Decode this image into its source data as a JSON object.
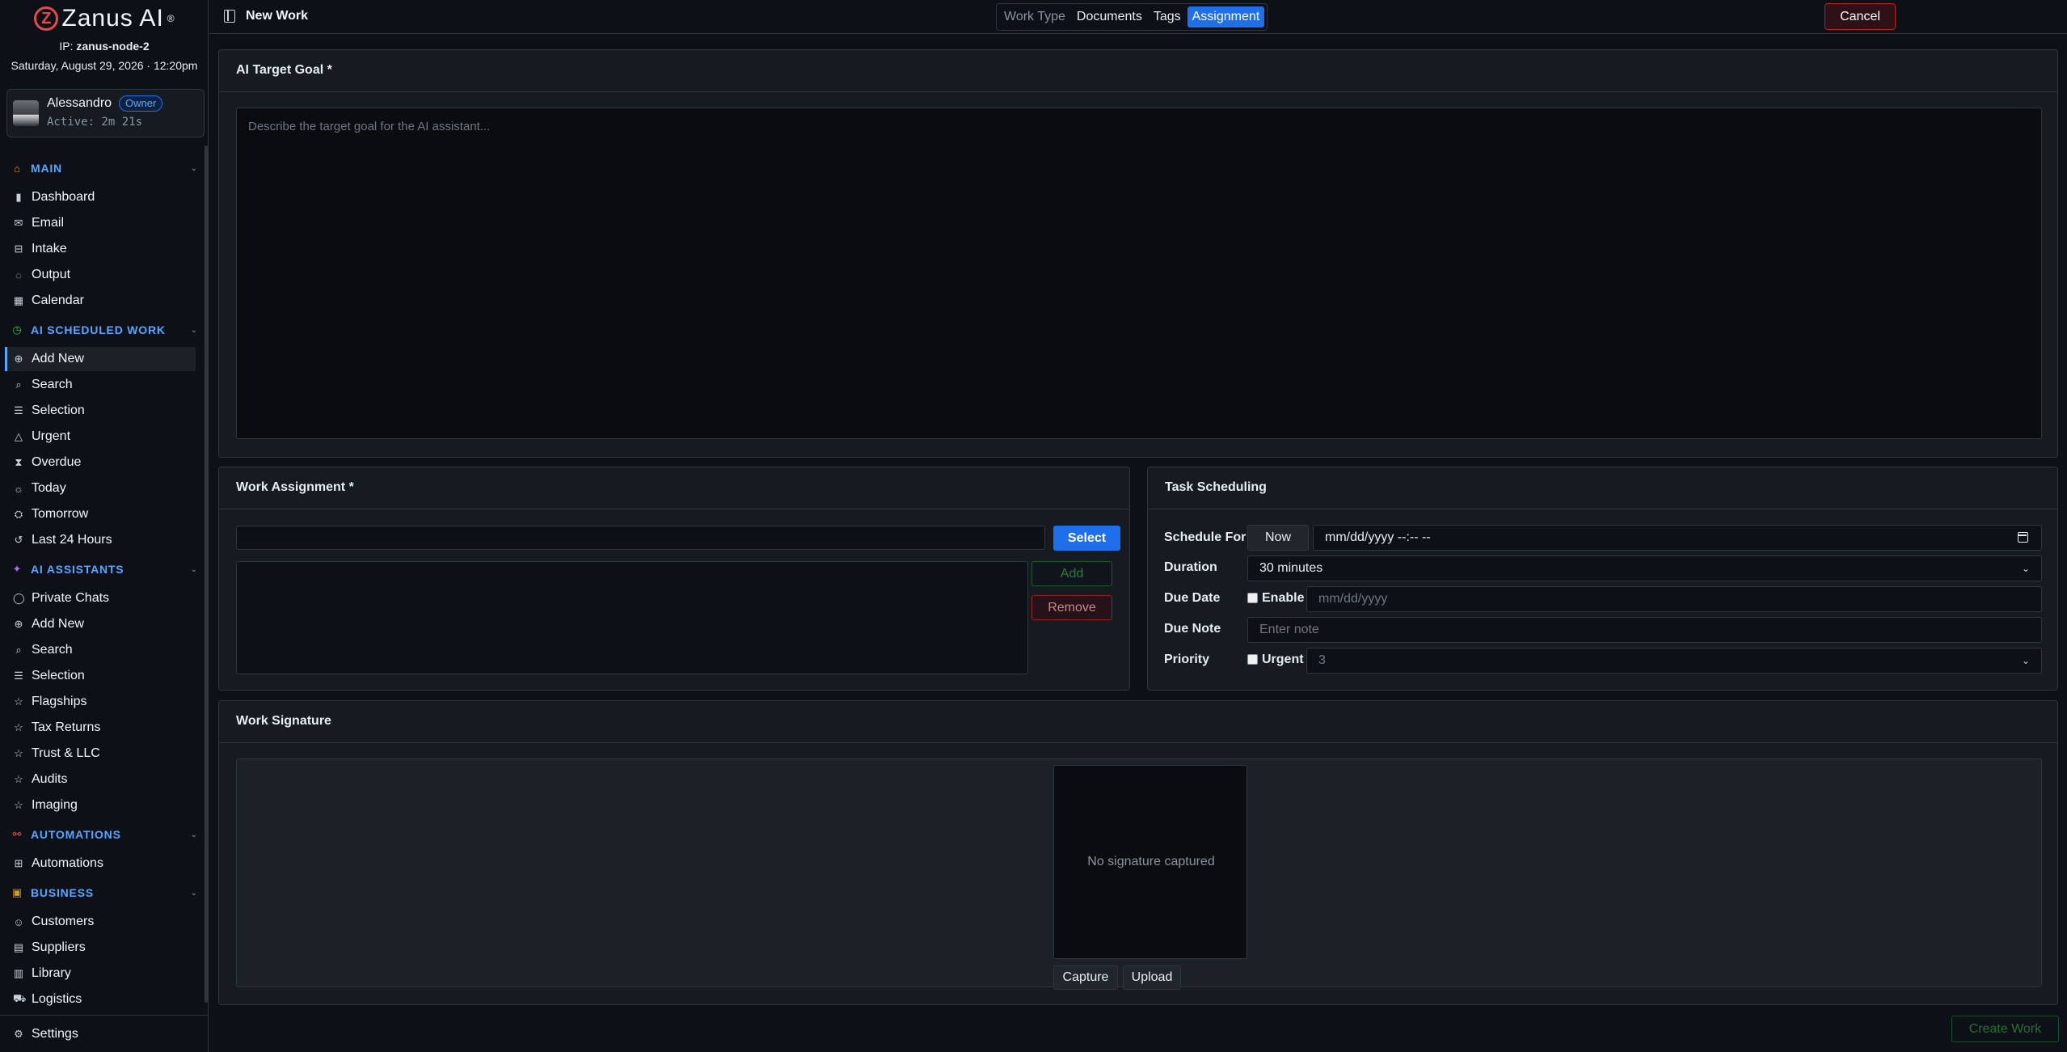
{
  "brand": {
    "name": "Zanus AI",
    "mark": "Z",
    "reg": "®"
  },
  "system": {
    "ip_label": "IP:",
    "ip_value": "zanus-node-2",
    "datetime": "Saturday, August 29, 2026 · 12:20pm"
  },
  "user": {
    "name": "Alessandro",
    "role": "Owner",
    "active": "Active: 2m 21s"
  },
  "sidebar": {
    "sections": [
      {
        "title": "MAIN",
        "icon": "home-icon",
        "color": "#f0883e",
        "items": [
          {
            "label": "Dashboard",
            "icon": "bar-chart-icon"
          },
          {
            "label": "Email",
            "icon": "mail-icon"
          },
          {
            "label": "Intake",
            "icon": "inbox-icon"
          },
          {
            "label": "Output",
            "icon": "export-icon"
          },
          {
            "label": "Calendar",
            "icon": "calendar-icon"
          }
        ]
      },
      {
        "title": "AI SCHEDULED WORK",
        "icon": "timer-icon",
        "color": "#3fb950",
        "items": [
          {
            "label": "Add New",
            "icon": "plus-circle-icon",
            "active": true
          },
          {
            "label": "Search",
            "icon": "search-icon"
          },
          {
            "label": "Selection",
            "icon": "list-icon"
          },
          {
            "label": "Urgent",
            "icon": "warning-icon"
          },
          {
            "label": "Overdue",
            "icon": "hourglass-icon"
          },
          {
            "label": "Today",
            "icon": "sun-icon"
          },
          {
            "label": "Tomorrow",
            "icon": "sunrise-icon"
          },
          {
            "label": "Last 24 Hours",
            "icon": "history-icon"
          }
        ]
      },
      {
        "title": "AI ASSISTANTS",
        "icon": "sparkle-icon",
        "color": "#a371f7",
        "items": [
          {
            "label": "Private Chats",
            "icon": "chat-icon"
          },
          {
            "label": "Add New",
            "icon": "plus-circle-icon"
          },
          {
            "label": "Search",
            "icon": "search-icon"
          },
          {
            "label": "Selection",
            "icon": "list-icon"
          },
          {
            "label": "Flagships",
            "icon": "star-icon"
          },
          {
            "label": "Tax Returns",
            "icon": "star-icon"
          },
          {
            "label": "Trust & LLC",
            "icon": "star-icon"
          },
          {
            "label": "Audits",
            "icon": "star-icon"
          },
          {
            "label": "Imaging",
            "icon": "star-icon"
          }
        ]
      },
      {
        "title": "AUTOMATIONS",
        "icon": "workflow-icon",
        "color": "#f85149",
        "items": [
          {
            "label": "Automations",
            "icon": "grid-icon"
          }
        ]
      },
      {
        "title": "BUSINESS",
        "icon": "briefcase-icon",
        "color": "#d29922",
        "items": [
          {
            "label": "Customers",
            "icon": "users-icon"
          },
          {
            "label": "Suppliers",
            "icon": "building-icon"
          },
          {
            "label": "Library",
            "icon": "book-icon"
          },
          {
            "label": "Logistics",
            "icon": "truck-icon"
          }
        ]
      }
    ],
    "settings": {
      "label": "Settings",
      "icon": "gear-icon"
    }
  },
  "header": {
    "title": "New Work",
    "tabs": [
      {
        "label": "Work Type",
        "state": "muted"
      },
      {
        "label": "Documents",
        "state": "normal"
      },
      {
        "label": "Tags",
        "state": "normal"
      },
      {
        "label": "Assignment",
        "state": "active"
      }
    ],
    "cancel_label": "Cancel"
  },
  "goal": {
    "title": "AI Target Goal *",
    "placeholder": "Describe the target goal for the AI assistant..."
  },
  "assignment": {
    "title": "Work Assignment *",
    "select_label": "Select",
    "add_label": "Add",
    "remove_label": "Remove"
  },
  "scheduling": {
    "title": "Task Scheduling",
    "schedule_for_label": "Schedule For",
    "now_label": "Now",
    "datetime_placeholder": "mm/dd/yyyy --:-- --",
    "duration_label": "Duration",
    "duration_value": "30 minutes",
    "due_date_label": "Due Date",
    "enable_label": "Enable",
    "due_date_placeholder": "mm/dd/yyyy",
    "due_note_label": "Due Note",
    "due_note_placeholder": "Enter note",
    "priority_label": "Priority",
    "urgent_label": "Urgent",
    "priority_value": "3"
  },
  "signature": {
    "title": "Work Signature",
    "empty_text": "No signature captured",
    "capture_label": "Capture",
    "upload_label": "Upload"
  },
  "footer": {
    "create_label": "Create Work"
  }
}
